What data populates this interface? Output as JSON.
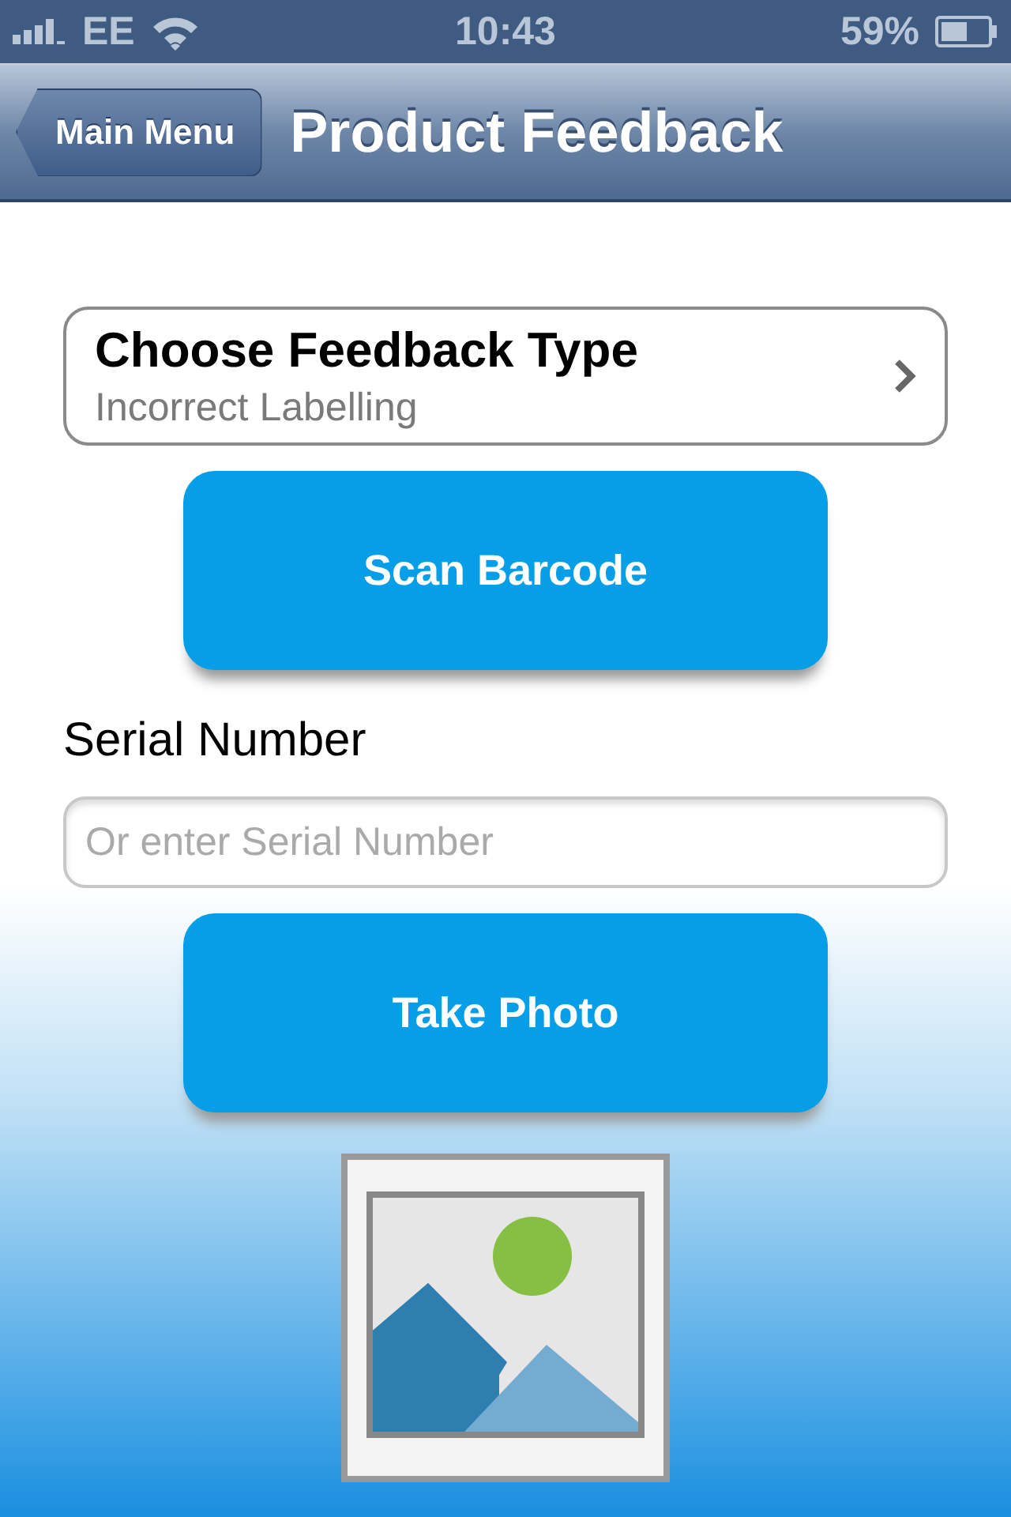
{
  "status_bar": {
    "carrier": "EE",
    "time": "10:43",
    "battery": "59%"
  },
  "nav_bar": {
    "back_button": "Main Menu",
    "title": "Product Feedback"
  },
  "feedback_type": {
    "title": "Choose Feedback Type",
    "value": "Incorrect Labelling"
  },
  "scan_button": "Scan Barcode",
  "serial_number": {
    "label": "Serial Number",
    "placeholder": "Or enter Serial Number"
  },
  "photo_button": "Take Photo"
}
